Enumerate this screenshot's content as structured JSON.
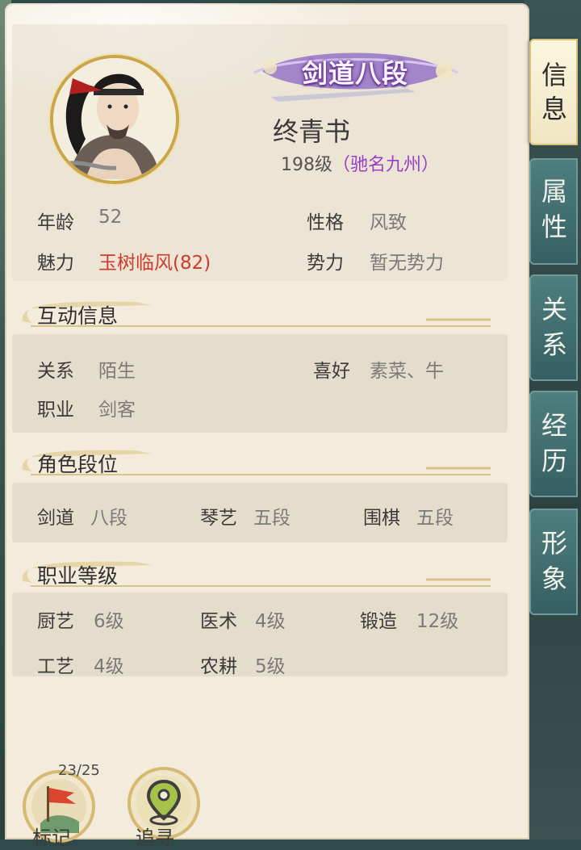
{
  "character": {
    "rank_badge": "剑道八段",
    "name": "终青书",
    "level": "198级",
    "fame": "（驰名九州）"
  },
  "basic": {
    "age_label": "年龄",
    "age_value": "52",
    "personality_label": "性格",
    "personality_value": "风致",
    "charm_label": "魅力",
    "charm_value": "玉树临风(82)",
    "faction_label": "势力",
    "faction_value": "暂无势力"
  },
  "interaction": {
    "title": "互动信息",
    "relation_label": "关系",
    "relation_value": "陌生",
    "hobby_label": "喜好",
    "hobby_value": "素菜、牛",
    "job_label": "职业",
    "job_value": "剑客"
  },
  "rank_section": {
    "title": "角色段位",
    "items": [
      {
        "label": "剑道",
        "value": "八段"
      },
      {
        "label": "琴艺",
        "value": "五段"
      },
      {
        "label": "围棋",
        "value": "五段"
      }
    ]
  },
  "job_section": {
    "title": "职业等级",
    "items": [
      {
        "label": "厨艺",
        "value": "6级"
      },
      {
        "label": "医术",
        "value": "4级"
      },
      {
        "label": "锻造",
        "value": "12级"
      },
      {
        "label": "工艺",
        "value": "4级"
      },
      {
        "label": "农耕",
        "value": "5级"
      }
    ]
  },
  "tabs": [
    {
      "line1": "信",
      "line2": "息"
    },
    {
      "line1": "属",
      "line2": "性"
    },
    {
      "line1": "关",
      "line2": "系"
    },
    {
      "line1": "经",
      "line2": "历"
    },
    {
      "line1": "形",
      "line2": "象"
    }
  ],
  "bottom": {
    "counter": "23/25",
    "mark_label": "标记",
    "track_label": "追寻"
  },
  "colors": {
    "panel": "#f3ecdd",
    "tab_active": "#fbf6df",
    "tab_inactive": "#4f7f7f",
    "rank_purple": "#6b3a9c",
    "charm_red": "#cf3a2c",
    "fame_purple": "#9a3fc4"
  }
}
